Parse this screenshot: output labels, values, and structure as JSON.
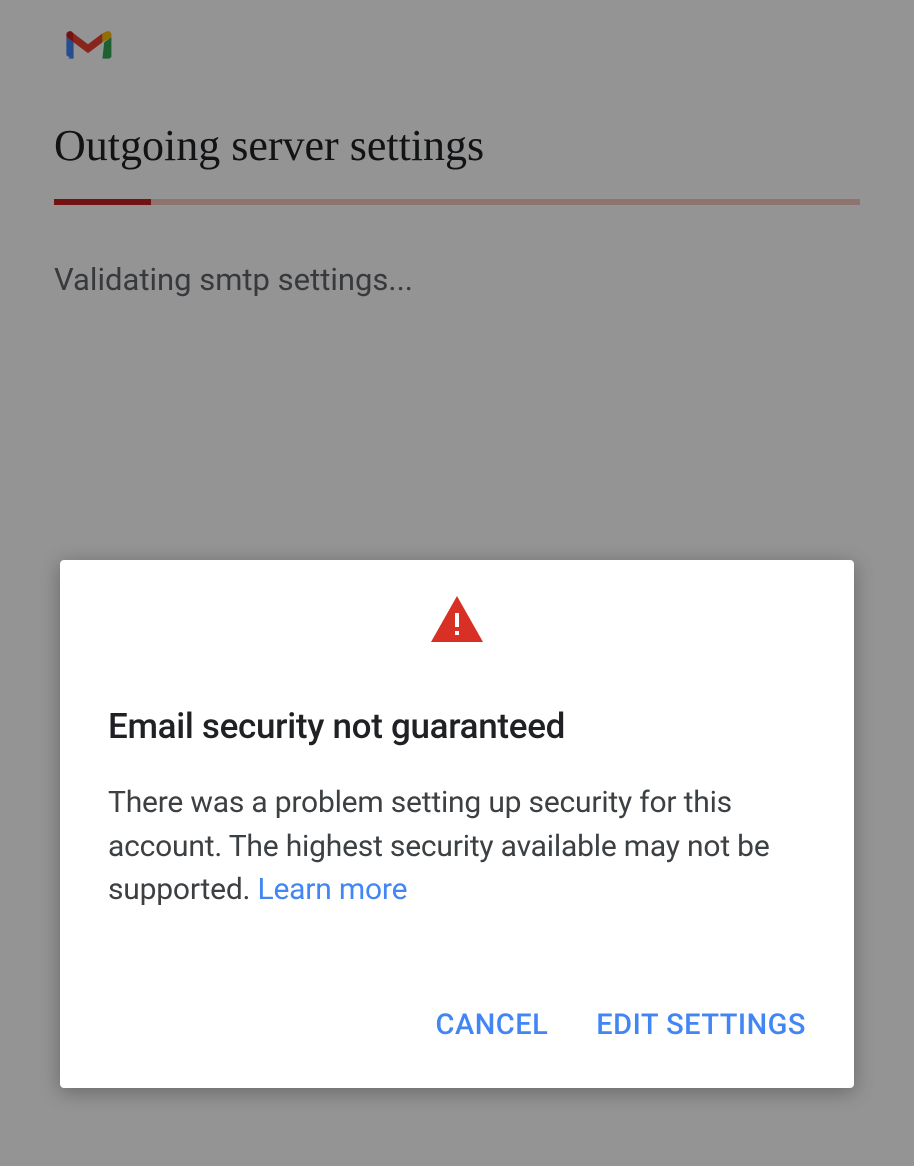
{
  "page": {
    "title": "Outgoing server settings",
    "status": "Validating smtp settings..."
  },
  "dialog": {
    "title": "Email security not guaranteed",
    "body": "There was a problem setting up security for this account. The highest security available may not be supported. ",
    "learn_more": "Learn more",
    "cancel_label": "CANCEL",
    "edit_label": "EDIT SETTINGS"
  }
}
